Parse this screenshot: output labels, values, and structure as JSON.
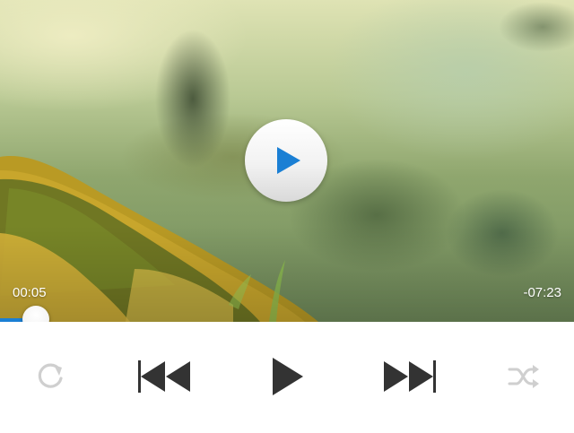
{
  "player": {
    "elapsed_time": "00:05",
    "remaining_time": "-07:23",
    "progress_fraction": 0.011,
    "accent_color": "#1a7fd4"
  },
  "controls": {
    "icons": [
      "repeat-icon",
      "previous-track-icon",
      "play-icon",
      "next-track-icon",
      "shuffle-icon"
    ]
  }
}
